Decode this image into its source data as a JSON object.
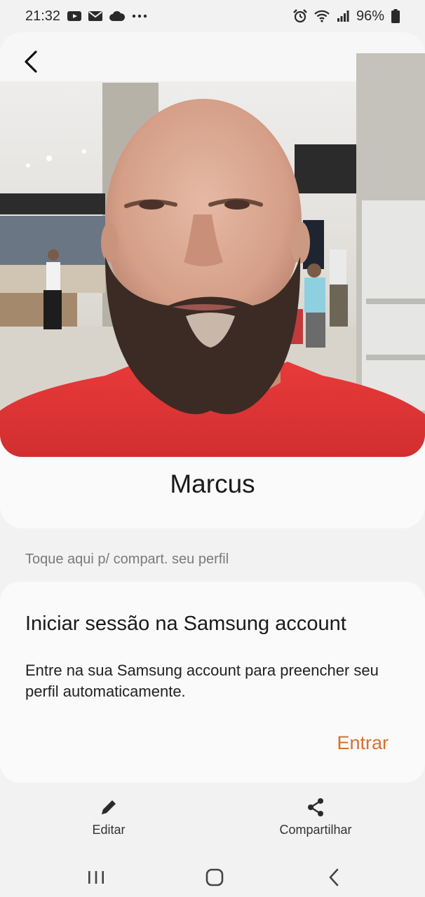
{
  "status": {
    "time": "21:32",
    "battery": "96%",
    "icons_left": [
      "youtube-icon",
      "mail-icon",
      "cloud-icon",
      "more-dots-icon"
    ],
    "icons_right": [
      "alarm-icon",
      "wifi-icon",
      "signal-icon",
      "battery-icon"
    ]
  },
  "profile": {
    "name": "Marcus",
    "photo": "profile-photo"
  },
  "share_hint": "Toque aqui p/ compart. seu perfil",
  "account_card": {
    "title": "Iniciar sessão na Samsung account",
    "description": "Entre na sua Samsung account para preencher seu perfil automaticamente.",
    "button_label": "Entrar",
    "button_color": "#d8702c"
  },
  "actions": {
    "edit_label": "Editar",
    "share_label": "Compartilhar"
  },
  "nav": {
    "icons": [
      "recent-apps-icon",
      "home-icon",
      "back-icon"
    ]
  }
}
